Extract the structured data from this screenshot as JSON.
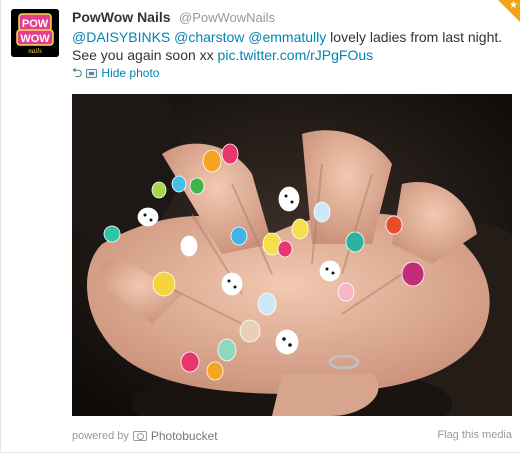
{
  "tweet": {
    "fullname": "PowWow Nails",
    "username": "@PowWowNails",
    "avatar_text": "POW WOW nails",
    "text_parts": [
      {
        "text": "@DAISYBINKS",
        "link": true
      },
      {
        "text": " ",
        "link": false
      },
      {
        "text": "@charstow",
        "link": true
      },
      {
        "text": " ",
        "link": false
      },
      {
        "text": "@emmatully",
        "link": true
      },
      {
        "text": " lovely ladies from last night. See you again soon xx ",
        "link": false
      },
      {
        "text": "pic.twitter.com/rJPgFOus",
        "link": true
      }
    ],
    "hide_photo_label": "Hide photo",
    "favorited": true
  },
  "media": {
    "powered_by_label": "powered by",
    "provider": "Photobucket",
    "flag_label": "Flag this media"
  },
  "colors": {
    "link": "#0084b4",
    "fav": "#f2a413"
  },
  "icons": {
    "favorite": "star-icon",
    "hide": "arrow-back-icon",
    "photo": "photo-icon",
    "provider": "camera-icon"
  }
}
